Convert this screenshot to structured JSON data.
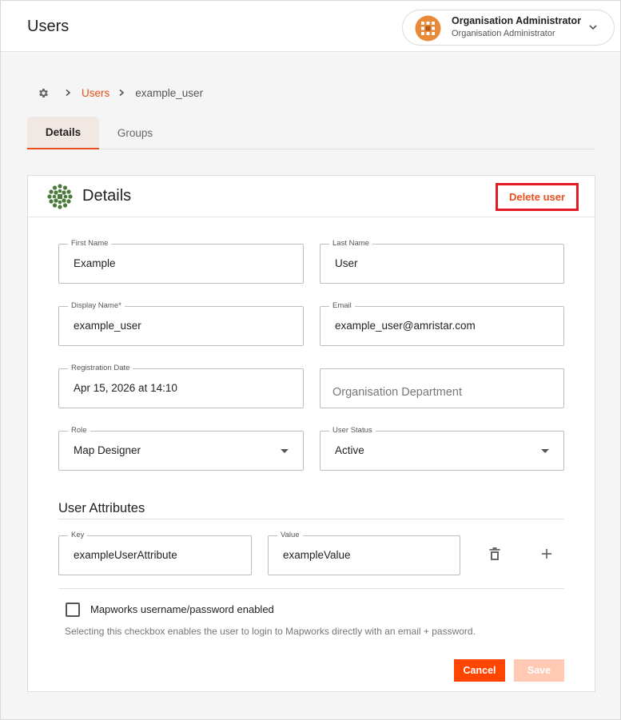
{
  "header": {
    "title": "Users",
    "user": {
      "name": "Organisation Administrator",
      "role": "Organisation Administrator"
    }
  },
  "breadcrumb": {
    "link": "Users",
    "current": "example_user"
  },
  "tabs": [
    {
      "label": "Details",
      "active": true
    },
    {
      "label": "Groups",
      "active": false
    }
  ],
  "card": {
    "title": "Details",
    "delete_label": "Delete user"
  },
  "form": {
    "first_name": {
      "label": "First Name",
      "value": "Example"
    },
    "last_name": {
      "label": "Last Name",
      "value": "User"
    },
    "display_name": {
      "label": "Display Name*",
      "value": "example_user"
    },
    "email": {
      "label": "Email",
      "value": "example_user@amristar.com"
    },
    "registration_date": {
      "label": "Registration Date",
      "value": "Apr 15, 2026 at 14:10"
    },
    "organisation_department": {
      "placeholder": "Organisation Department"
    },
    "role": {
      "label": "Role",
      "value": "Map Designer"
    },
    "user_status": {
      "label": "User Status",
      "value": "Active"
    }
  },
  "attributes": {
    "title": "User Attributes",
    "rows": [
      {
        "key_label": "Key",
        "key": "exampleUserAttribute",
        "value_label": "Value",
        "value": "exampleValue"
      }
    ]
  },
  "mapworks": {
    "checkbox_label": "Mapworks username/password enabled",
    "checked": false,
    "help": "Selecting this checkbox enables the user to login to Mapworks directly with an email + password."
  },
  "actions": {
    "cancel": "Cancel",
    "save": "Save"
  },
  "colors": {
    "accent": "#e8501f",
    "cancel_bg": "#ff4500",
    "save_disabled_bg": "#ffc9b3",
    "highlight_border": "#e01b24"
  },
  "icons": {
    "breadcrumb_root": "gear-icon",
    "attr_delete": "trash-icon",
    "attr_add": "plus-icon"
  }
}
